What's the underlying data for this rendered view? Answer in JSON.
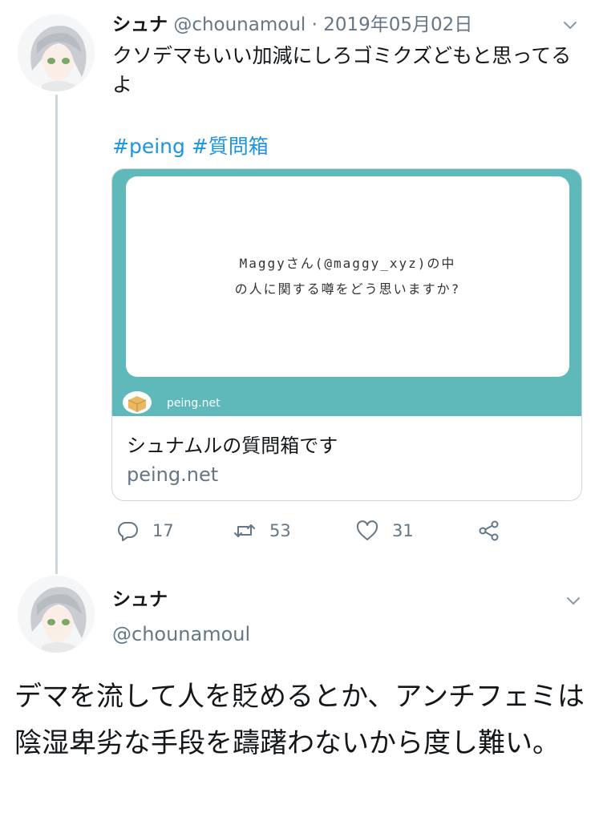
{
  "tweet1": {
    "name": "シュナ",
    "handle": "@chounamoul",
    "separator": " · ",
    "date": "2019年05月02日",
    "text": "クソデマもいい加減にしろゴミクズどもと思ってるよ",
    "hashtags": [
      "#peing",
      "#質問箱"
    ],
    "card": {
      "question_line1": "Maggyさん(@maggy_xyz)の中",
      "question_line2": "の人に関する噂をどう思いますか?",
      "image_domain": "peing.net",
      "title": "シュナムルの質問箱です",
      "domain": "peing.net"
    },
    "stats": {
      "replies": "17",
      "retweets": "53",
      "likes": "31"
    }
  },
  "tweet2": {
    "name": "シュナ",
    "handle": "@chounamoul",
    "text": "デマを流して人を貶めるとか、アンチフェミは陰湿卑劣な手段を躊躇わないから度し難い。"
  },
  "colors": {
    "link": "#1b95e0",
    "muted": "#657786",
    "card_accent": "#5fb9bb",
    "thread_line": "#cdd6dd"
  },
  "icons": {
    "avatar": "anime-avatar",
    "menu": "chevron-down-icon",
    "reply": "reply-icon",
    "retweet": "retweet-icon",
    "like": "heart-icon",
    "share": "share-icon",
    "card_logo": "peing-box-icon"
  }
}
